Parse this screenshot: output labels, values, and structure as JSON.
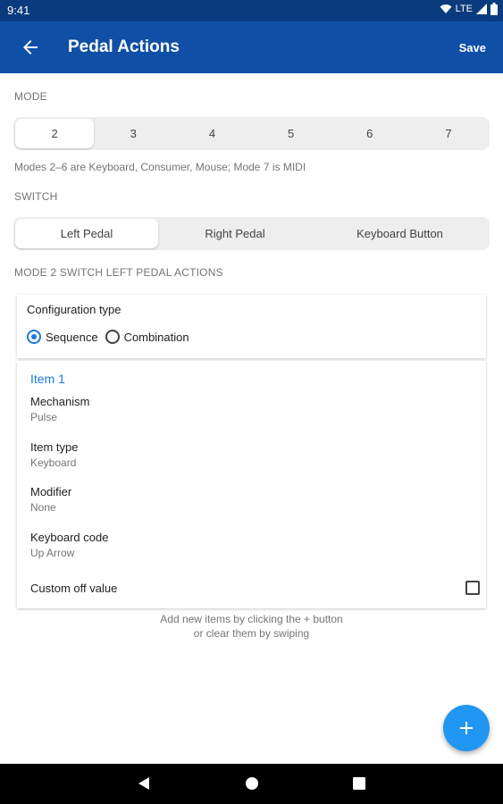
{
  "status_bar": {
    "time": "9:41",
    "network": "LTE",
    "icons": [
      "wifi-icon",
      "signal-icon",
      "battery-icon"
    ]
  },
  "app_bar": {
    "title": "Pedal Actions",
    "save_label": "Save",
    "back_icon": "arrow-back-icon"
  },
  "mode": {
    "label": "MODE",
    "options": [
      "2",
      "3",
      "4",
      "5",
      "6",
      "7"
    ],
    "selected": "2",
    "hint": "Modes 2–6 are Keyboard, Consumer, Mouse; Mode 7 is MIDI"
  },
  "switch": {
    "label": "SWITCH",
    "options": [
      "Left Pedal",
      "Right Pedal",
      "Keyboard Button"
    ],
    "selected": "Left Pedal"
  },
  "actions_label": "MODE 2 SWITCH LEFT PEDAL ACTIONS",
  "config": {
    "title": "Configuration type",
    "options": [
      "Sequence",
      "Combination"
    ],
    "selected": "Sequence"
  },
  "item": {
    "title": "Item 1",
    "fields": [
      {
        "label": "Mechanism",
        "value": "Pulse"
      },
      {
        "label": "Item type",
        "value": "Keyboard"
      },
      {
        "label": "Modifier",
        "value": "None"
      },
      {
        "label": "Keyboard code",
        "value": "Up Arrow"
      }
    ],
    "custom_off_label": "Custom off value",
    "custom_off_checked": false
  },
  "footer_hint": {
    "line1": "Add new items by clicking the + button",
    "line2": "or clear them by swiping"
  },
  "fab_icon": "plus-icon",
  "colors": {
    "primary": "#0f4fa6",
    "status_bar": "#0a3b7e",
    "accent": "#1e7ae0",
    "fab": "#2196f3"
  }
}
